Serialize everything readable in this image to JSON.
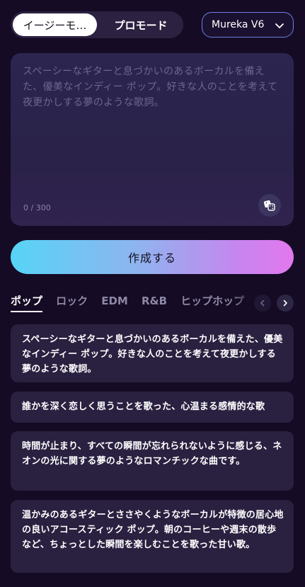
{
  "mode_toggle": {
    "easy_label": "イージーモ…",
    "pro_label": "プロモード"
  },
  "model_select": {
    "value": "Mureka V6",
    "icon": "chevron-down-icon"
  },
  "prompt": {
    "placeholder": "スペーシーなギターと息づかいのあるボーカルを備えた、優美なインディー ポップ。好きな人のことを考えて夜更かしする夢のような歌詞。",
    "char_count": "0 / 300",
    "dice_icon": "dice-icon"
  },
  "create_button": {
    "label": "作成する"
  },
  "genre_tabs": [
    {
      "label": "ポップ",
      "active": true
    },
    {
      "label": "ロック",
      "active": false
    },
    {
      "label": "EDM",
      "active": false
    },
    {
      "label": "R&B",
      "active": false
    },
    {
      "label": "ヒップホップ",
      "active": false
    }
  ],
  "suggestions": [
    {
      "text": "スペーシーなギターと息づかいのあるボーカルを備えた、優美なインディー ポップ。好きな人のことを考えて夜更かしする夢のような歌詞。"
    },
    {
      "text": "誰かを深く恋しく思うことを歌った、心温まる感情的な歌"
    },
    {
      "text": "時間が止まり、すべての瞬間が忘れられないように感じる、ネオンの光に関する夢のようなロマンチックな曲です。"
    },
    {
      "text": "温かみのあるギターとささやくようなボーカルが特徴の居心地の良いアコースティック ポップ。朝のコーヒーや週末の散歩など、ちょっとした瞬間を楽しむことを歌った甘い歌。"
    }
  ],
  "colors": {
    "background": "#150b24",
    "card": "#2a2040",
    "accent_start": "#56d4f7",
    "accent_end": "#e277ee",
    "model_border": "#6f7fe0"
  }
}
